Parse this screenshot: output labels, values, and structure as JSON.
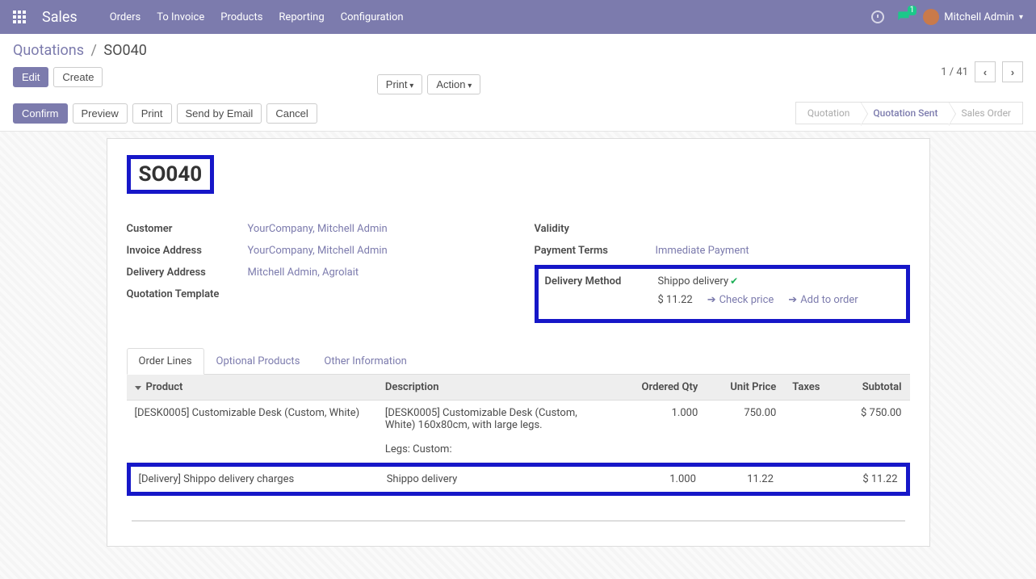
{
  "navbar": {
    "brand": "Sales",
    "links": [
      "Orders",
      "To Invoice",
      "Products",
      "Reporting",
      "Configuration"
    ],
    "badge_count": "1",
    "user_name": "Mitchell Admin"
  },
  "breadcrumb": {
    "parent": "Quotations",
    "current": "SO040"
  },
  "buttons": {
    "edit": "Edit",
    "create": "Create",
    "print": "Print",
    "action": "Action",
    "pager": "1 / 41"
  },
  "action_buttons": {
    "confirm": "Confirm",
    "preview": "Preview",
    "print": "Print",
    "send_email": "Send by Email",
    "cancel": "Cancel"
  },
  "status_steps": [
    "Quotation",
    "Quotation Sent",
    "Sales Order"
  ],
  "record": {
    "title": "SO040"
  },
  "fields_left": {
    "customer_label": "Customer",
    "customer_value": "YourCompany, Mitchell Admin",
    "invoice_label": "Invoice Address",
    "invoice_value": "YourCompany, Mitchell Admin",
    "delivery_addr_label": "Delivery Address",
    "delivery_addr_value": "Mitchell Admin, Agrolait",
    "quote_tpl_label": "Quotation Template"
  },
  "fields_right": {
    "validity_label": "Validity",
    "payment_label": "Payment Terms",
    "payment_value": "Immediate Payment",
    "delivery_method_label": "Delivery Method",
    "delivery_method_value": "Shippo delivery",
    "delivery_price": "$ 11.22",
    "check_price": "Check price",
    "add_to_order": "Add to order"
  },
  "tabs": {
    "order_lines": "Order Lines",
    "optional": "Optional Products",
    "other": "Other Information"
  },
  "table": {
    "headers": {
      "product": "Product",
      "description": "Description",
      "qty": "Ordered Qty",
      "unit_price": "Unit Price",
      "taxes": "Taxes",
      "subtotal": "Subtotal"
    },
    "row1": {
      "product": "[DESK0005] Customizable Desk (Custom, White)",
      "description": "[DESK0005] Customizable Desk (Custom, White) 160x80cm, with large legs.\n\nLegs: Custom:",
      "qty": "1.000",
      "unit_price": "750.00",
      "taxes": "",
      "subtotal": "$ 750.00"
    },
    "row2": {
      "product": "[Delivery] Shippo delivery charges",
      "description": "Shippo delivery",
      "qty": "1.000",
      "unit_price": "11.22",
      "taxes": "",
      "subtotal": "$ 11.22"
    }
  }
}
